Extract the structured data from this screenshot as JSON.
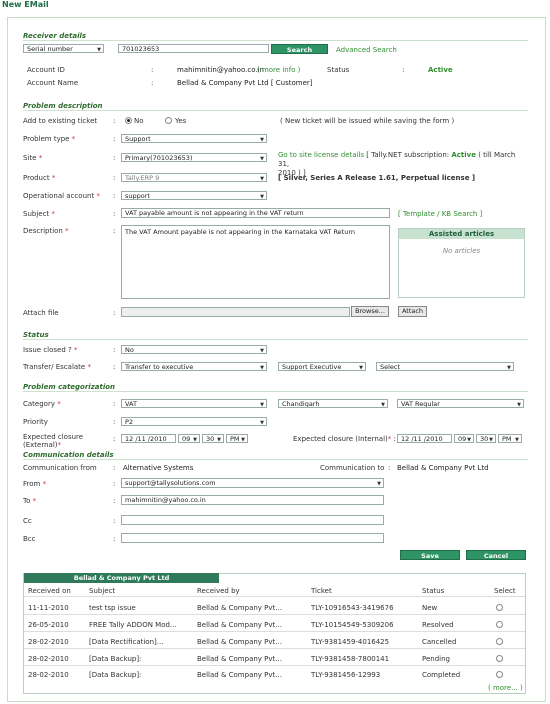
{
  "window_title": "New EMail",
  "receiver": {
    "section": "Receiver details",
    "search_by": "Serial number",
    "search_value": "701023653",
    "search_label": "Search",
    "advanced_search": "Advanced Search",
    "account_id_label": "Account ID",
    "account_id": "mahimnitin@yahoo.co.in",
    "more_info": "( more info )",
    "status_label": "Status",
    "status_value": "Active",
    "account_name_label": "Account Name",
    "account_name": "Bellad & Company Pvt Ltd [ Customer]"
  },
  "problem": {
    "section": "Problem description",
    "existing_label": "Add to existing ticket",
    "opt_no": "No",
    "opt_yes": "Yes",
    "new_ticket_note": "( New ticket will be issued while saving the form )",
    "type_label": "Problem type",
    "type_value": "Support",
    "site_label": "Site",
    "site_value": "Primary(701023653)",
    "site_link": "Go to site license details",
    "site_info_a": "[ Tally.NET subscription:",
    "site_info_status": "Active",
    "site_info_b": "( till March 31,",
    "site_info_c": "2010 ) ]",
    "product_label": "Product",
    "product_value": "Tally.ERP 9",
    "product_info": "[ Silver, Series A Release 1.61, Perpetual license ]",
    "opacct_label": "Operational account",
    "opacct_value": "support",
    "subject_label": "Subject",
    "subject_value": "VAT payable amount is not appearing in the VAT return",
    "template_link": "[ Template / KB Search ]",
    "desc_label": "Description",
    "desc_value": "The VAT Amount payable is not appearing in the Karnataka VAT Return",
    "assisted_title": "Assisted articles",
    "assisted_empty": "No articles",
    "attach_label": "Attach file",
    "browse_label": "Browse...",
    "attach_btn": "Attach"
  },
  "status_section": {
    "section": "Status",
    "closed_label": "Issue closed ?",
    "closed_value": "No",
    "transfer_label": "Transfer/ Escalate",
    "transfer_value": "Transfer to executive",
    "exec_value": "Support Executive",
    "select_value": "Select"
  },
  "categorization": {
    "section": "Problem categorization",
    "category_label": "Category",
    "category_value": "VAT",
    "state_value": "Chandigarh",
    "subcat_value": "VAT Regular",
    "priority_label": "Priority",
    "priority_value": "P2",
    "ext_label_a": "Expected closure",
    "ext_label_b": "(External)",
    "ext_date": "12 /11 /2010",
    "ext_hour": "09",
    "ext_min": "30",
    "ext_ampm": "PM",
    "int_label": "Expected closure (Internal)",
    "int_date": "12 /11 /2010",
    "int_hour": "09",
    "int_min": "30",
    "int_ampm": "PM"
  },
  "communication": {
    "section": "Communication details",
    "from_label": "Communication from",
    "from_value": "Alternative Systems",
    "to_label": "Communication to",
    "to_value": "Bellad & Company Pvt Ltd",
    "email_from_label": "From",
    "email_from_value": "support@tallysolutions.com",
    "email_to_label": "To",
    "email_to_value": "mahimnitin@yahoo.co.in",
    "cc_label": "Cc",
    "bcc_label": "Bcc",
    "save": "Save",
    "cancel": "Cancel"
  },
  "history": {
    "tab": "Bellad & Company Pvt Ltd",
    "columns": [
      "Received on",
      "Subject",
      "Received by",
      "Ticket",
      "Status",
      "Select"
    ],
    "rows": [
      [
        "11-11-2010",
        "test tsp issue",
        "Bellad & Company Pvt...",
        "TLY-10916543-3419676",
        "New"
      ],
      [
        "26-05-2010",
        "FREE Tally ADDON Mod...",
        "Bellad & Company Pvt...",
        "TLY-10154549-5309206",
        "Resolved"
      ],
      [
        "28-02-2010",
        "[Data Rectification]...",
        "Bellad & Company Pvt...",
        "TLY-9381459-4016425",
        "Cancelled"
      ],
      [
        "28-02-2010",
        "[Data Backup]:",
        "Bellad & Company Pvt...",
        "TLY-9381458-7800141",
        "Pending"
      ],
      [
        "28-02-2010",
        "[Data Backup]:",
        "Bellad & Company Pvt...",
        "TLY-9381456-12993",
        "Completed"
      ]
    ],
    "more": "( more... )"
  },
  "colors": {
    "accent": "#2e9466",
    "section": "#2f6b2f",
    "required": "#d0302f"
  }
}
